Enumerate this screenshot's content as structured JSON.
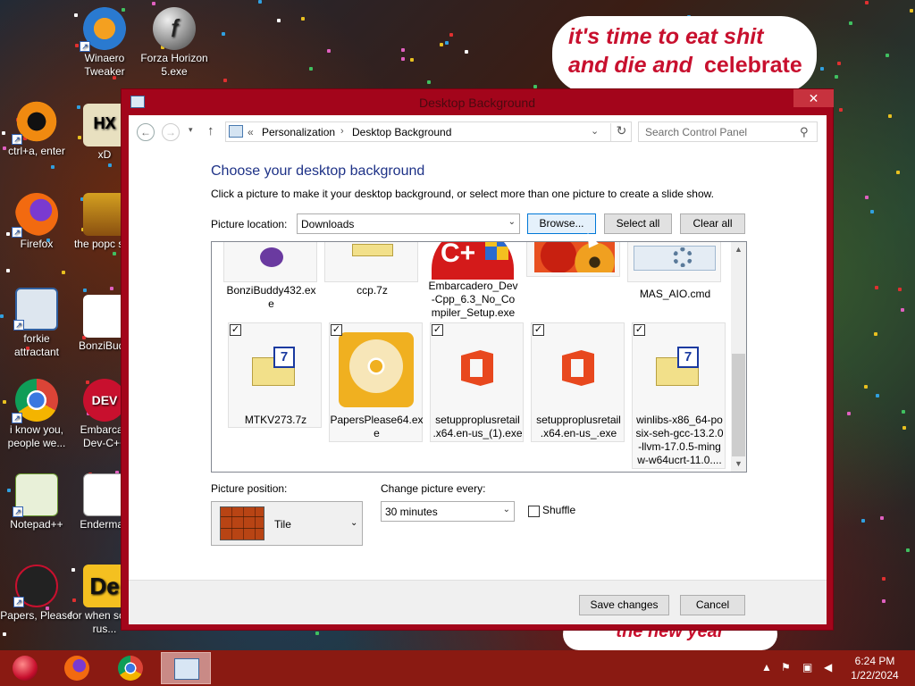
{
  "desktop": {
    "icons": [
      {
        "label": "Winaero Tweaker"
      },
      {
        "label": "Forza Horizon 5.exe"
      },
      {
        "label": "ctrl+a, enter"
      },
      {
        "label": "xD"
      },
      {
        "label": "Firefox"
      },
      {
        "label": "the popc shit"
      },
      {
        "label": "forkie attractant"
      },
      {
        "label": "BonziBudd"
      },
      {
        "label": "i know you, people we..."
      },
      {
        "label": "Embarcad Dev-C++"
      },
      {
        "label": "Notepad++"
      },
      {
        "label": "Enderman"
      },
      {
        "label": "Papers, Please"
      },
      {
        "label": "for when some rus..."
      }
    ],
    "bubble_top": {
      "line1": "it's time to eat shit",
      "line2": "and die and",
      "line3": "celebrate",
      "line4": "the new year"
    },
    "bubble_bottom": {
      "text": "the new year"
    }
  },
  "window": {
    "title": "Desktop Background",
    "close_label": "✕",
    "min_label": "—",
    "max_label": "☐"
  },
  "nav": {
    "back_label": "←",
    "forward_label": "→",
    "dropdown_label": "▾",
    "up_label": "↑",
    "crumb_prefix": "«",
    "crumbs": [
      "Personalization",
      "Desktop Background"
    ],
    "crumb_sep": "›",
    "address_dd": "⌄",
    "refresh_label": "↻",
    "search_placeholder": "Search Control Panel",
    "search_icon": "⚲"
  },
  "main": {
    "heading": "Choose your desktop background",
    "subtext": "Click a picture to make it your desktop background, or select more than one picture to create a slide show.",
    "picture_location_label": "Picture location:",
    "picture_location_value": "Downloads",
    "browse_label": "Browse...",
    "select_all_label": "Select all",
    "clear_all_label": "Clear all"
  },
  "pictures": {
    "row1": [
      {
        "name": "BonziBuddy432.exe",
        "line1": "BonziBuddy432.ex",
        "line2": "e",
        "icon": "bonzi-icon"
      },
      {
        "name": "ccp.7z",
        "line1": "ccp.7z",
        "line2": "",
        "icon": "archive-7z-icon"
      },
      {
        "name": "Embarcadero_Dev-Cpp_6.3_No_Compiler_Setup.exe",
        "line1": "Embarcadero_Dev",
        "line2": "-Cpp_6.3_No_Co",
        "line3": "mpiler_Setup.exe",
        "icon": "devcpp-icon"
      },
      {
        "name": "flowers",
        "line1": "",
        "line2": "",
        "icon": "flower-image"
      },
      {
        "name": "MAS_AIO.cmd",
        "line1": "MAS_AIO.cmd",
        "line2": "",
        "icon": "cmd-gears-icon"
      }
    ],
    "row2": [
      {
        "name": "MTKV273.7z",
        "line1": "MTKV273.7z",
        "line2": "",
        "icon": "archive-7z-icon",
        "checked": true
      },
      {
        "name": "PapersPlease64.exe",
        "line1": "PapersPlease64.ex",
        "line2": "e",
        "icon": "disc-installer-icon",
        "checked": true
      },
      {
        "name": "setupproplusretail.x64.en-us_(1).exe",
        "line1": "setupproplusretail",
        "line2": ".x64.en-us_(1).exe",
        "icon": "office-icon",
        "checked": true
      },
      {
        "name": "setupproplusretail.x64.en-us_.exe",
        "line1": "setupproplusretail",
        "line2": ".x64.en-us_.exe",
        "icon": "office-icon",
        "checked": true
      },
      {
        "name": "winlibs",
        "line1": "winlibs-x86_64-po",
        "line2": "six-seh-gcc-13.2.0",
        "line3": "-llvm-17.0.5-ming",
        "line4": "w-w64ucrt-11.0....",
        "icon": "archive-7z-icon",
        "checked": true
      }
    ],
    "check_glyph": "✓"
  },
  "options": {
    "position_label": "Picture position:",
    "position_value": "Tile",
    "change_label": "Change picture every:",
    "change_value": "30 minutes",
    "shuffle_label": "Shuffle",
    "arrow": "⌄"
  },
  "footer": {
    "save_label": "Save changes",
    "cancel_label": "Cancel"
  },
  "taskbar": {
    "time": "6:24 PM",
    "date": "1/22/2024",
    "tray_up": "▲"
  },
  "colors": {
    "accent": "#a3051b",
    "heading": "#1e3287",
    "taskbar": "#8a1a12"
  }
}
